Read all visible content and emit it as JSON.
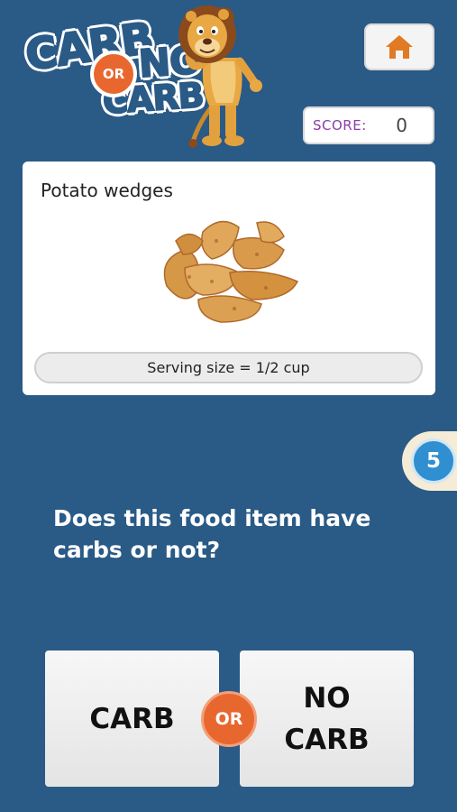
{
  "logo": {
    "word_carb": "CARB",
    "word_or": "OR",
    "word_no": "NO",
    "word_carb2": "CARB",
    "mascot": "lion-mascot"
  },
  "header": {
    "home_icon": "home-icon",
    "score_label": "SCORE:",
    "score_value": "0"
  },
  "card": {
    "food_name": "Potato wedges",
    "food_image": "potato-wedges-image",
    "serving_size": "Serving size = 1/2 cup"
  },
  "timer": {
    "value": "5"
  },
  "question": "Does this food item have carbs or not?",
  "answers": {
    "carb_label": "CARB",
    "or_label": "OR",
    "nocarb_line1": "NO",
    "nocarb_line2": "CARB"
  },
  "colors": {
    "background": "#2a5a86",
    "accent_orange": "#e8672f",
    "score_label": "#8a3ea8",
    "timer_blue": "#2f8fd1"
  }
}
